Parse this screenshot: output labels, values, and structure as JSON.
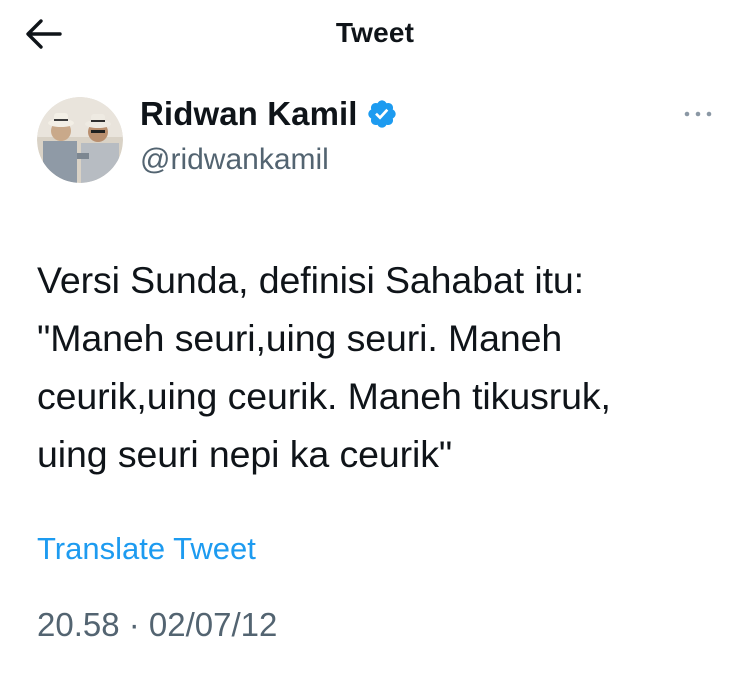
{
  "header": {
    "title": "Tweet",
    "back_icon": "arrow-left-icon"
  },
  "author": {
    "name": "Ridwan Kamil",
    "handle": "@ridwankamil",
    "verified": true,
    "verified_icon": "verified-badge-icon",
    "more_icon": "more-horizontal-icon"
  },
  "tweet": {
    "text": "Versi Sunda, definisi Sahabat itu:\n\"Maneh seuri,uing seuri. Maneh\nceurik,uing ceurik. Maneh tikusruk,\nuing seuri nepi ka ceurik\"",
    "translate_label": "Translate Tweet",
    "timestamp": "20.58 · 02/07/12"
  },
  "colors": {
    "text": "#0f1419",
    "secondary": "#536471",
    "accent": "#1d9bf0"
  }
}
